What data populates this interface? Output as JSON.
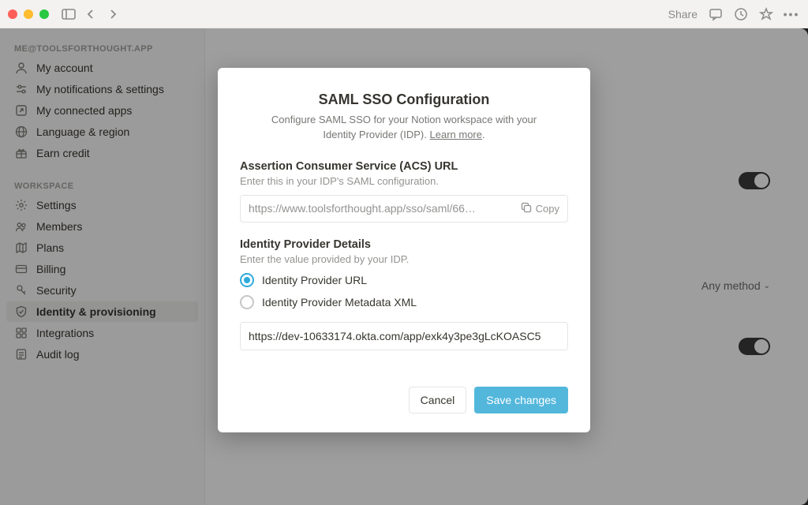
{
  "titlebar": {
    "share_label": "Share"
  },
  "sidebar": {
    "account_header": "ME@TOOLSFORTHOUGHT.APP",
    "account_items": [
      {
        "label": "My account"
      },
      {
        "label": "My notifications & settings"
      },
      {
        "label": "My connected apps"
      },
      {
        "label": "Language & region"
      },
      {
        "label": "Earn credit"
      }
    ],
    "workspace_header": "WORKSPACE",
    "workspace_items": [
      {
        "label": "Settings"
      },
      {
        "label": "Members"
      },
      {
        "label": "Plans"
      },
      {
        "label": "Billing"
      },
      {
        "label": "Security"
      },
      {
        "label": "Identity & provisioning"
      },
      {
        "label": "Integrations"
      },
      {
        "label": "Audit log"
      }
    ]
  },
  "content": {
    "any_method_label": "Any method"
  },
  "modal": {
    "title": "SAML SSO Configuration",
    "subtitle_a": "Configure SAML SSO for your Notion workspace with your Identity Provider (IDP). ",
    "learn_more": "Learn more",
    "acs": {
      "title": "Assertion Consumer Service (ACS) URL",
      "desc": "Enter this in your IDP's SAML configuration.",
      "url": "https://www.toolsforthought.app/sso/saml/66…",
      "copy_label": "Copy"
    },
    "idp": {
      "title": "Identity Provider Details",
      "desc": "Enter the value provided by your IDP.",
      "option_url": "Identity Provider URL",
      "option_xml": "Identity Provider Metadata XML",
      "input_value": "https://dev-10633174.okta.com/app/exk4y3pe3gLcKOASC5"
    },
    "cancel_label": "Cancel",
    "save_label": "Save changes"
  }
}
